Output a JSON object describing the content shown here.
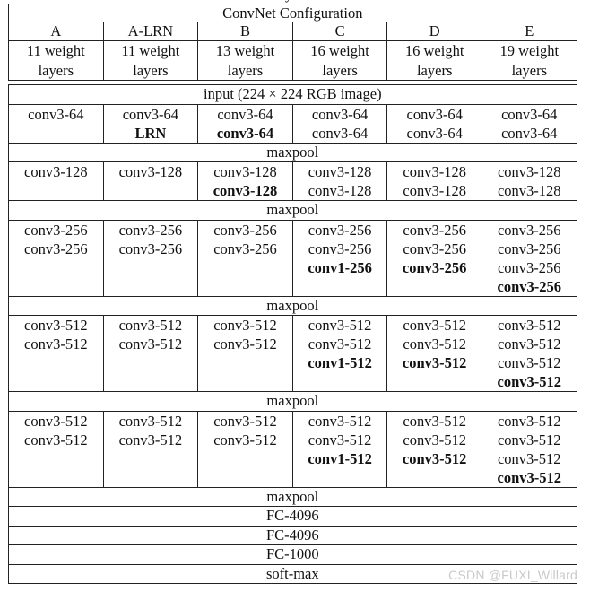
{
  "caption_fragment": "y",
  "header": {
    "title": "ConvNet Configuration",
    "configs": [
      {
        "name": "A",
        "weights_line1": "11 weight",
        "weights_line2": "layers"
      },
      {
        "name": "A-LRN",
        "weights_line1": "11 weight",
        "weights_line2": "layers"
      },
      {
        "name": "B",
        "weights_line1": "13 weight",
        "weights_line2": "layers"
      },
      {
        "name": "C",
        "weights_line1": "16 weight",
        "weights_line2": "layers"
      },
      {
        "name": "D",
        "weights_line1": "16 weight",
        "weights_line2": "layers"
      },
      {
        "name": "E",
        "weights_line1": "19 weight",
        "weights_line2": "layers"
      }
    ]
  },
  "body": {
    "input": "input (224 × 224 RGB image)",
    "maxpool": "maxpool",
    "blocks": [
      [
        [
          {
            "t": "conv3-64"
          }
        ],
        [
          {
            "t": "conv3-64"
          },
          {
            "t": "LRN",
            "b": true
          }
        ],
        [
          {
            "t": "conv3-64"
          },
          {
            "t": "conv3-64",
            "b": true
          }
        ],
        [
          {
            "t": "conv3-64"
          },
          {
            "t": "conv3-64"
          }
        ],
        [
          {
            "t": "conv3-64"
          },
          {
            "t": "conv3-64"
          }
        ],
        [
          {
            "t": "conv3-64"
          },
          {
            "t": "conv3-64"
          }
        ]
      ],
      [
        [
          {
            "t": "conv3-128"
          }
        ],
        [
          {
            "t": "conv3-128"
          }
        ],
        [
          {
            "t": "conv3-128"
          },
          {
            "t": "conv3-128",
            "b": true
          }
        ],
        [
          {
            "t": "conv3-128"
          },
          {
            "t": "conv3-128"
          }
        ],
        [
          {
            "t": "conv3-128"
          },
          {
            "t": "conv3-128"
          }
        ],
        [
          {
            "t": "conv3-128"
          },
          {
            "t": "conv3-128"
          }
        ]
      ],
      [
        [
          {
            "t": "conv3-256"
          },
          {
            "t": "conv3-256"
          }
        ],
        [
          {
            "t": "conv3-256"
          },
          {
            "t": "conv3-256"
          }
        ],
        [
          {
            "t": "conv3-256"
          },
          {
            "t": "conv3-256"
          }
        ],
        [
          {
            "t": "conv3-256"
          },
          {
            "t": "conv3-256"
          },
          {
            "t": "conv1-256",
            "b": true
          }
        ],
        [
          {
            "t": "conv3-256"
          },
          {
            "t": "conv3-256"
          },
          {
            "t": "conv3-256",
            "b": true
          }
        ],
        [
          {
            "t": "conv3-256"
          },
          {
            "t": "conv3-256"
          },
          {
            "t": "conv3-256"
          },
          {
            "t": "conv3-256",
            "b": true
          }
        ]
      ],
      [
        [
          {
            "t": "conv3-512"
          },
          {
            "t": "conv3-512"
          }
        ],
        [
          {
            "t": "conv3-512"
          },
          {
            "t": "conv3-512"
          }
        ],
        [
          {
            "t": "conv3-512"
          },
          {
            "t": "conv3-512"
          }
        ],
        [
          {
            "t": "conv3-512"
          },
          {
            "t": "conv3-512"
          },
          {
            "t": "conv1-512",
            "b": true
          }
        ],
        [
          {
            "t": "conv3-512"
          },
          {
            "t": "conv3-512"
          },
          {
            "t": "conv3-512",
            "b": true
          }
        ],
        [
          {
            "t": "conv3-512"
          },
          {
            "t": "conv3-512"
          },
          {
            "t": "conv3-512"
          },
          {
            "t": "conv3-512",
            "b": true
          }
        ]
      ],
      [
        [
          {
            "t": "conv3-512"
          },
          {
            "t": "conv3-512"
          }
        ],
        [
          {
            "t": "conv3-512"
          },
          {
            "t": "conv3-512"
          }
        ],
        [
          {
            "t": "conv3-512"
          },
          {
            "t": "conv3-512"
          }
        ],
        [
          {
            "t": "conv3-512"
          },
          {
            "t": "conv3-512"
          },
          {
            "t": "conv1-512",
            "b": true
          }
        ],
        [
          {
            "t": "conv3-512"
          },
          {
            "t": "conv3-512"
          },
          {
            "t": "conv3-512",
            "b": true
          }
        ],
        [
          {
            "t": "conv3-512"
          },
          {
            "t": "conv3-512"
          },
          {
            "t": "conv3-512"
          },
          {
            "t": "conv3-512",
            "b": true
          }
        ]
      ]
    ],
    "tail": [
      "maxpool",
      "FC-4096",
      "FC-4096",
      "FC-1000",
      "soft-max"
    ]
  },
  "watermark": "CSDN @FUXI_Willard"
}
